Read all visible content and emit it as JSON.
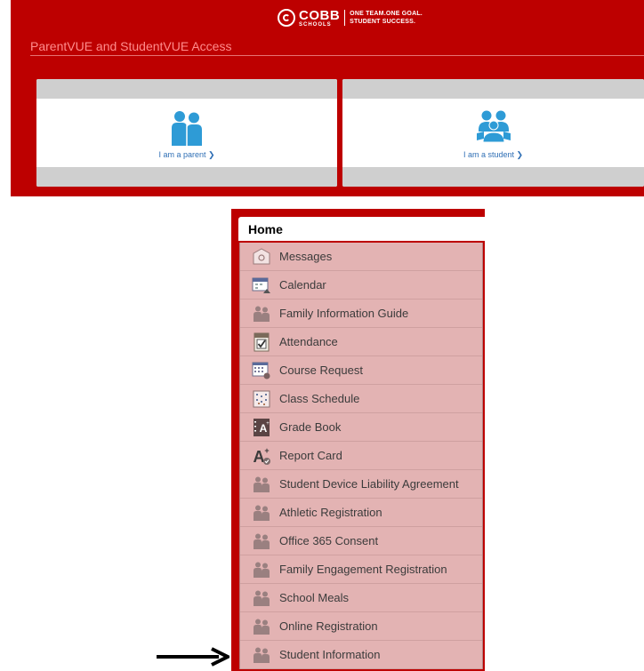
{
  "logo": {
    "name": "COBB",
    "sub": "SCHOOLS",
    "tagline_line1": "ONE TEAM.ONE GOAL.",
    "tagline_line2": "STUDENT SUCCESS."
  },
  "access": {
    "title": "ParentVUE and StudentVUE Access",
    "parent_link": "I am a parent",
    "student_link": "I am a student"
  },
  "menu": {
    "home_label": "Home",
    "items": [
      {
        "label": "Messages",
        "icon": "envelope-icon"
      },
      {
        "label": "Calendar",
        "icon": "calendar-icon"
      },
      {
        "label": "Family Information Guide",
        "icon": "people-icon"
      },
      {
        "label": "Attendance",
        "icon": "attendance-checkbox-icon"
      },
      {
        "label": "Course Request",
        "icon": "course-request-icon"
      },
      {
        "label": "Class Schedule",
        "icon": "class-schedule-icon"
      },
      {
        "label": "Grade Book",
        "icon": "grade-book-icon"
      },
      {
        "label": "Report Card",
        "icon": "report-card-icon"
      },
      {
        "label": "Student Device Liability Agreement",
        "icon": "people-icon"
      },
      {
        "label": "Athletic Registration",
        "icon": "people-icon"
      },
      {
        "label": "Office 365 Consent",
        "icon": "people-icon"
      },
      {
        "label": "Family Engagement Registration",
        "icon": "people-icon"
      },
      {
        "label": "School Meals",
        "icon": "people-icon"
      },
      {
        "label": "Online Registration",
        "icon": "people-icon"
      },
      {
        "label": "Student Information",
        "icon": "people-icon"
      }
    ]
  },
  "colors": {
    "brand_red": "#bd0000",
    "menu_bg": "#e3b3b3",
    "link_blue": "#2f6fb5",
    "icon_blue": "#2e9bd6"
  }
}
